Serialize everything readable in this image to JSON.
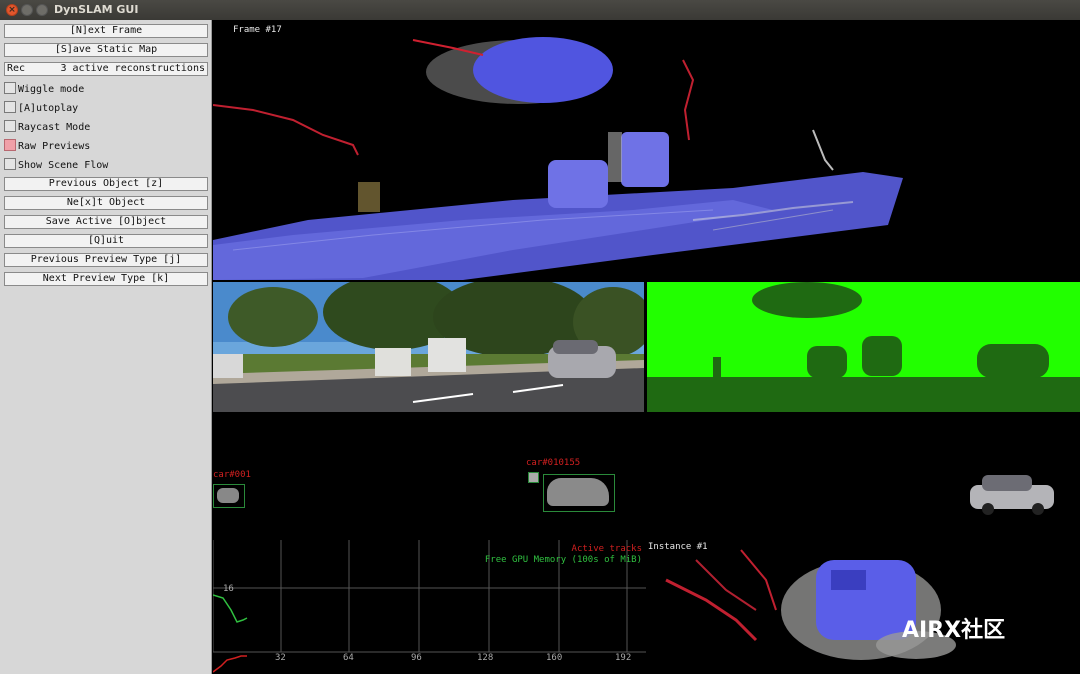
{
  "window": {
    "title": "DynSLAM GUI"
  },
  "panel": {
    "next_frame": "[N]ext Frame",
    "save_static_map": "[S]ave Static Map",
    "rec_label": "Rec",
    "rec_value": "3 active reconstructions",
    "wiggle_mode": "Wiggle mode",
    "autoplay": "[A]utoplay",
    "raycast_mode": "Raycast Mode",
    "raw_previews": "Raw Previews",
    "show_scene_flow": "Show Scene Flow",
    "previous_object": "Previous Object [z]",
    "next_object": "Ne[x]t Object",
    "save_active_object": "Save Active [O]bject",
    "quit": "[Q]uit",
    "previous_preview_type": "Previous Preview Type [j]",
    "next_preview_type": "Next Preview Type [k]"
  },
  "checkboxes": {
    "wiggle_mode": false,
    "autoplay": false,
    "raycast_mode": false,
    "raw_previews": true,
    "show_scene_flow": false
  },
  "main_view": {
    "frame_label": "Frame #17"
  },
  "segmentation": {
    "label_left": "car#001",
    "label_right": "car#010155"
  },
  "plot": {
    "legend_tracks": "Active tracks",
    "legend_memory": "Free GPU Memory (100s of MiB)",
    "y_tick": "16",
    "x_ticks": [
      "32",
      "64",
      "96",
      "128",
      "160",
      "192"
    ],
    "colors": {
      "tracks": "#d02020",
      "memory": "#30c040",
      "grid": "#555555"
    }
  },
  "instance_view": {
    "label": "Instance #1"
  },
  "watermark": "AIRX社区",
  "colors": {
    "accent_blue": "#5058e0",
    "depth_green": "#22ff00",
    "depth_dark": "#1f5a12"
  }
}
